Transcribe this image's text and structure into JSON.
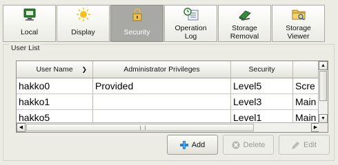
{
  "tabs": [
    {
      "label": "Local",
      "icon": "monitor-icon",
      "active": false
    },
    {
      "label": "Display",
      "icon": "sun-icon",
      "active": false
    },
    {
      "label": "Security",
      "icon": "padlock-icon",
      "active": true
    },
    {
      "label": "Operation\nLog",
      "line1": "Operation",
      "line2": "Log",
      "icon": "clock-log-icon",
      "active": false
    },
    {
      "label": "Storage Removal",
      "line1": "Storage",
      "line2": "Removal",
      "icon": "eject-icon",
      "active": false
    },
    {
      "label": "Storage Viewer",
      "line1": "Storage",
      "line2": "Viewer",
      "icon": "folder-icon",
      "active": false
    }
  ],
  "user_list": {
    "title": "User List",
    "columns": [
      "User Name",
      "Administrator Privileges",
      "Security",
      ""
    ],
    "sort_indicator": "chevron-down",
    "rows": [
      [
        "hakko0",
        "Provided",
        "Level5",
        "Scre"
      ],
      [
        "hakko1",
        "",
        "Level3",
        "Main"
      ],
      [
        "hakko5",
        "",
        "Level1",
        "Main"
      ]
    ]
  },
  "buttons": {
    "add": "Add",
    "delete": "Delete",
    "edit": "Edit"
  },
  "colors": {
    "background": "#ecece4",
    "active_tab": "#a8a8a4",
    "add_icon": "#2b7fd4"
  }
}
